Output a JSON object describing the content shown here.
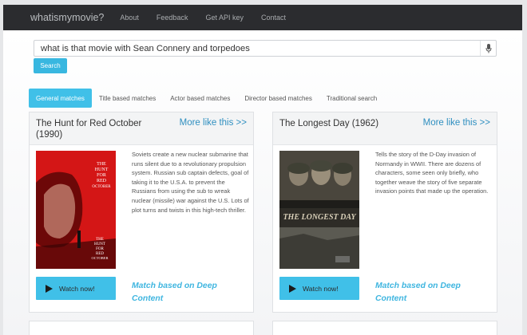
{
  "nav": {
    "brand": "whatismymovie?",
    "links": [
      "About",
      "Feedback",
      "Get API key",
      "Contact"
    ]
  },
  "search": {
    "value": "what is that movie with Sean Connery and torpedoes",
    "button_label": "Search"
  },
  "tabs": [
    {
      "label": "General matches",
      "active": true
    },
    {
      "label": "Title based matches",
      "active": false
    },
    {
      "label": "Actor based matches",
      "active": false
    },
    {
      "label": "Director based matches",
      "active": false
    },
    {
      "label": "Traditional search",
      "active": false
    }
  ],
  "results": [
    {
      "title": "The Hunt for Red October (1990)",
      "more_link": "More like this >>",
      "poster_text": [
        "THE",
        "HUNT",
        "FOR",
        "RED",
        "OCTOBER"
      ],
      "description": "Soviets create a new nuclear submarine that runs silent due to a revolutionary propulsion system. Russian sub captain defects, goal of taking it to the U.S.A. to prevent the Russians from using the sub to wreak nuclear (missile) war against the U.S. Lots of plot turns and twists in this high-tech thriller.",
      "watch_label": "Watch now!",
      "match_label": "Match based on Deep Content"
    },
    {
      "title": "The Longest Day (1962)",
      "more_link": "More like this >>",
      "poster_text": [
        "THE LONGEST DAY"
      ],
      "description": "Tells the story of the D-Day invasion of Normandy in WWII. There are dozens of characters, some seen only briefly, who together weave the story of five separate invasion points that made up the operation.",
      "watch_label": "Watch now!",
      "match_label": "Match based on Deep Content"
    }
  ],
  "colors": {
    "navbar": "#2b2c2f",
    "accent": "#40c0e8",
    "link": "#2f8fc0",
    "red_poster": "#d41616"
  },
  "icons": [
    "microphone-icon",
    "play-icon"
  ]
}
